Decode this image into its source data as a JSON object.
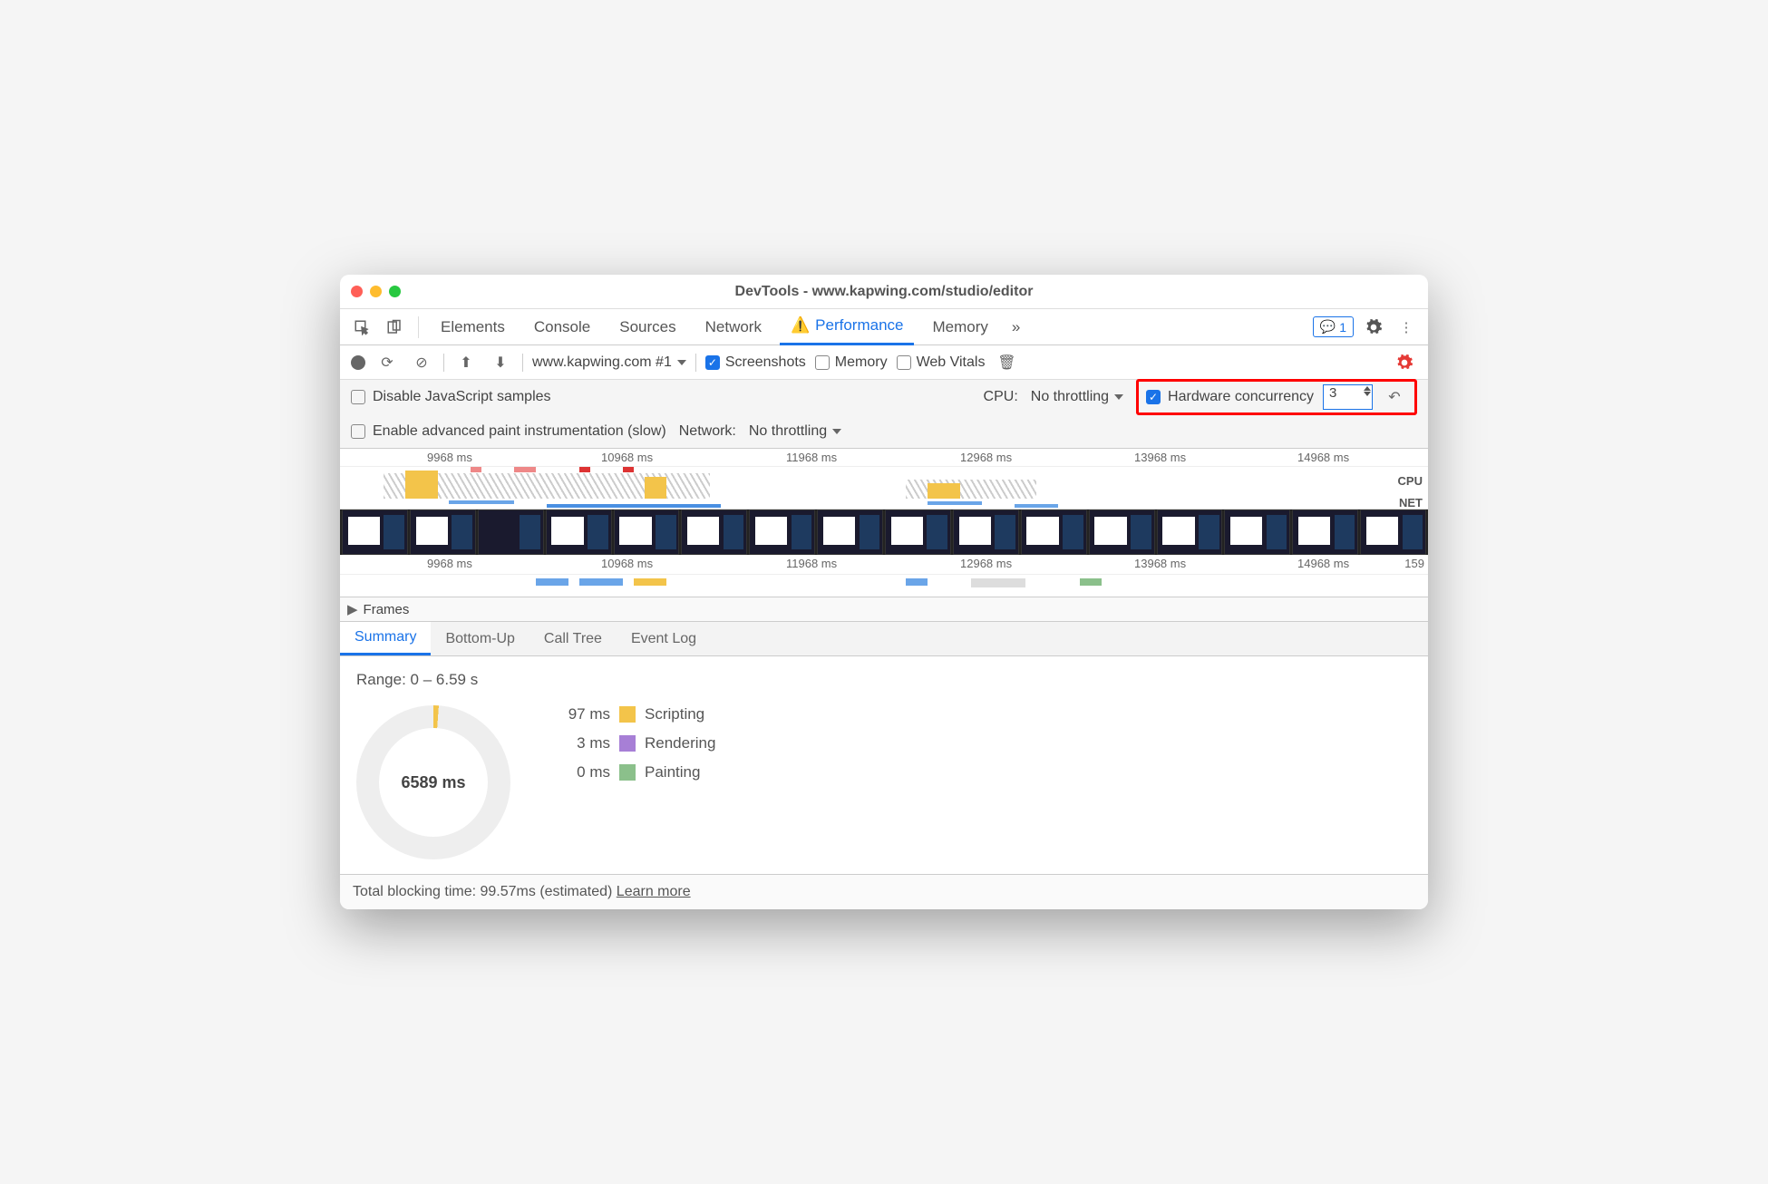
{
  "window": {
    "title": "DevTools - www.kapwing.com/studio/editor"
  },
  "tabs": {
    "items": [
      "Elements",
      "Console",
      "Sources",
      "Network",
      "Performance",
      "Memory"
    ],
    "active": "Performance",
    "overflow": "»",
    "message_count": "1"
  },
  "toolbar": {
    "target": "www.kapwing.com #1",
    "screenshots_label": "Screenshots",
    "memory_label": "Memory",
    "webvitals_label": "Web Vitals"
  },
  "settings": {
    "disable_js_label": "Disable JavaScript samples",
    "cpu_label": "CPU:",
    "cpu_value": "No throttling",
    "hw_label": "Hardware concurrency",
    "hw_value": "3",
    "adv_paint_label": "Enable advanced paint instrumentation (slow)",
    "net_label": "Network:",
    "net_value": "No throttling"
  },
  "timeline": {
    "ticks": [
      "9968 ms",
      "10968 ms",
      "11968 ms",
      "12968 ms",
      "13968 ms",
      "14968 ms"
    ],
    "ticks2": [
      "9968 ms",
      "10968 ms",
      "11968 ms",
      "12968 ms",
      "13968 ms",
      "14968 ms",
      "159"
    ],
    "cpu_label": "CPU",
    "net_label": "NET",
    "frames_label": "Frames"
  },
  "subtabs": {
    "items": [
      "Summary",
      "Bottom-Up",
      "Call Tree",
      "Event Log"
    ],
    "active": "Summary"
  },
  "summary": {
    "range_label": "Range: 0 – 6.59 s",
    "total_ms": "6589 ms",
    "legend": [
      {
        "value": "97 ms",
        "color": "#f3c44a",
        "label": "Scripting"
      },
      {
        "value": "3 ms",
        "color": "#a77fd6",
        "label": "Rendering"
      },
      {
        "value": "0 ms",
        "color": "#8bc08b",
        "label": "Painting"
      }
    ]
  },
  "footer": {
    "text": "Total blocking time: 99.57ms (estimated)",
    "link": "Learn more"
  }
}
